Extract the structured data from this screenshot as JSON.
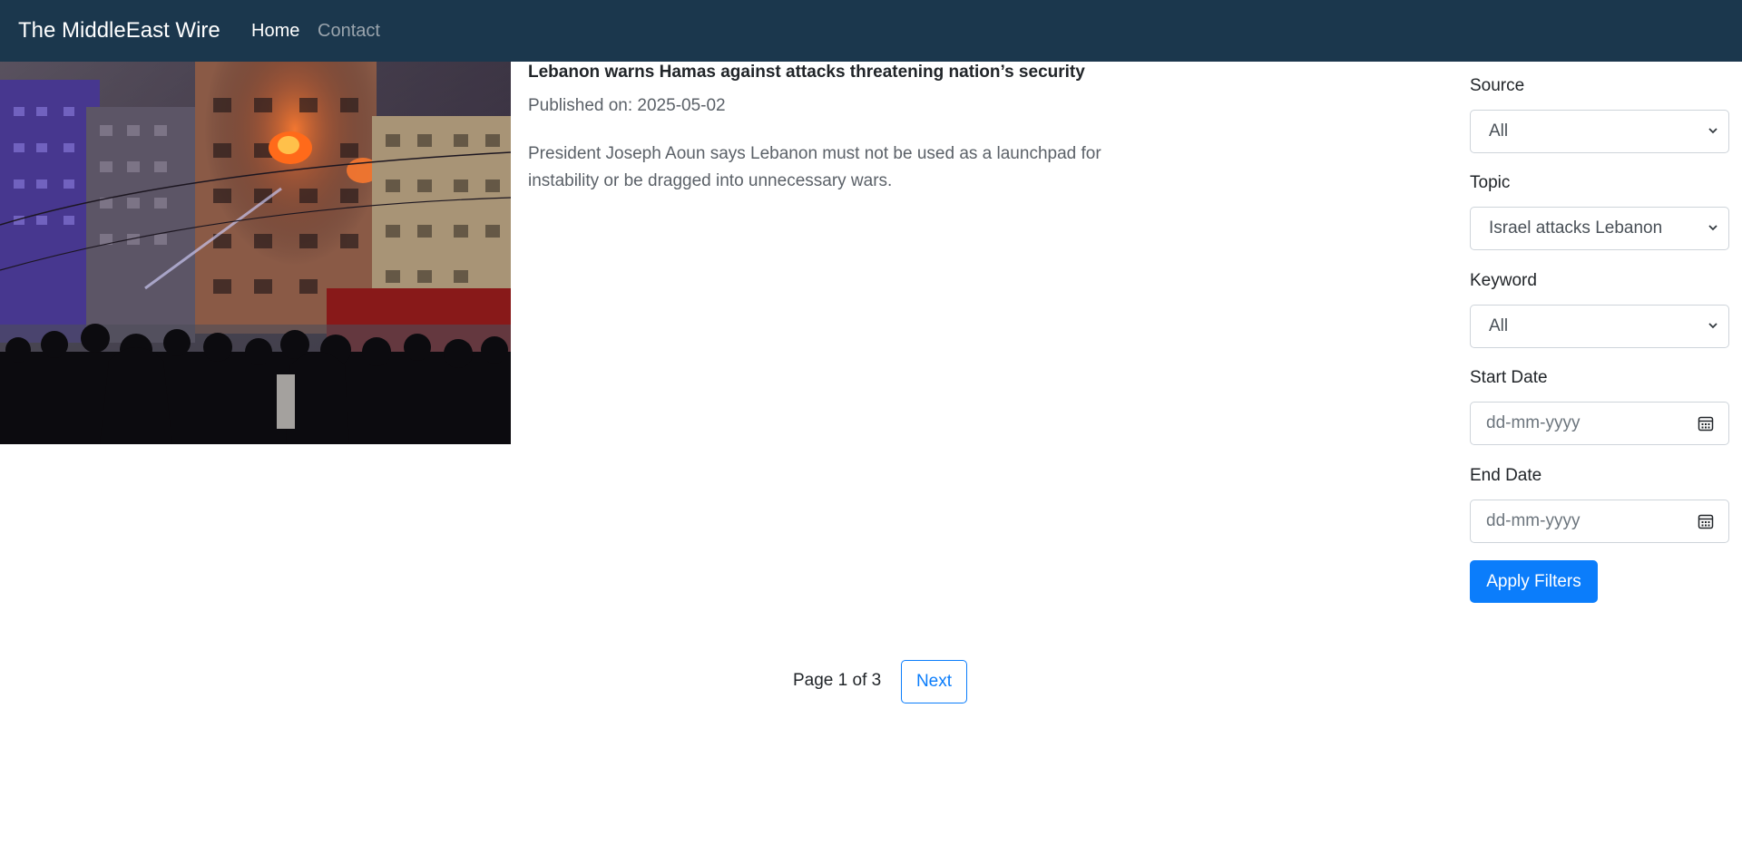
{
  "navbar": {
    "brand": "The MiddleEast Wire",
    "links": [
      {
        "label": "Home"
      },
      {
        "label": "Contact"
      }
    ]
  },
  "article": {
    "title": "Lebanon warns Hamas against attacks threatening nation’s security",
    "published": "Published on: 2025-05-02",
    "summary": "President Joseph Aoun says Lebanon must not be used as a launchpad for instability or be dragged into unnecessary wars."
  },
  "filters": {
    "source": {
      "label": "Source",
      "value": "All"
    },
    "topic": {
      "label": "Topic",
      "value": "Israel attacks Lebanon"
    },
    "keyword": {
      "label": "Keyword",
      "value": "All"
    },
    "start_date": {
      "label": "Start Date",
      "placeholder": "dd-mm-yyyy"
    },
    "end_date": {
      "label": "End Date",
      "placeholder": "dd-mm-yyyy"
    },
    "apply_label": "Apply Filters"
  },
  "pagination": {
    "status": "Page 1 of 3",
    "next_label": "Next"
  },
  "colors": {
    "navbar_bg": "#1b374d",
    "primary": "#0b7dfb"
  }
}
